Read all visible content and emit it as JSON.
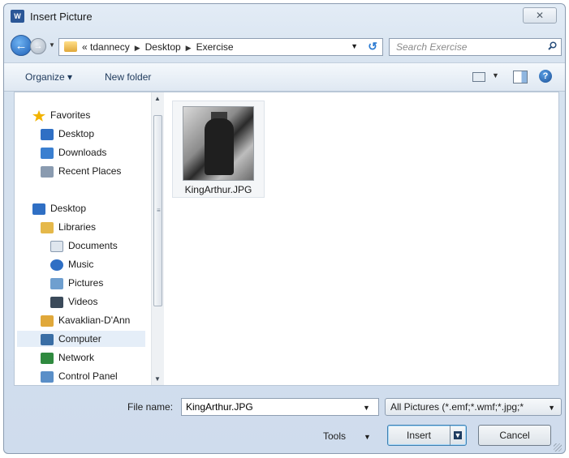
{
  "window": {
    "title": "Insert Picture",
    "app_icon_text": "W",
    "close_label": "✕"
  },
  "address": {
    "crumbs": [
      "« tdannecy",
      "Desktop",
      "Exercise"
    ],
    "search_placeholder": "Search Exercise"
  },
  "toolbar": {
    "organize_label": "Organize ▾",
    "new_folder_label": "New folder"
  },
  "nav": {
    "items": [
      {
        "label": "Favorites",
        "icon": "star-icon",
        "color": "#f2b300"
      },
      {
        "label": "Desktop",
        "icon": "desktop-icon",
        "color": "#2f6fc4"
      },
      {
        "label": "Downloads",
        "icon": "downloads-icon",
        "color": "#3a7fd0"
      },
      {
        "label": "Recent Places",
        "icon": "recent-places-icon",
        "color": "#8a9bb0"
      },
      {
        "label": "Desktop",
        "icon": "desktop-icon",
        "color": "#2f6fc4"
      },
      {
        "label": "Libraries",
        "icon": "libraries-icon",
        "color": "#e5b84a"
      },
      {
        "label": "Documents",
        "icon": "documents-icon",
        "color": "#dfe6ee"
      },
      {
        "label": "Music",
        "icon": "music-icon",
        "color": "#2f6fc4"
      },
      {
        "label": "Pictures",
        "icon": "pictures-icon",
        "color": "#6f9fcf"
      },
      {
        "label": "Videos",
        "icon": "videos-icon",
        "color": "#3b4a5a"
      },
      {
        "label": "Kavaklian-D'Ann",
        "icon": "user-folder-icon",
        "color": "#e0a83a"
      },
      {
        "label": "Computer",
        "icon": "computer-icon",
        "color": "#3a6ea5"
      },
      {
        "label": "Network",
        "icon": "network-icon",
        "color": "#2f8a3f"
      },
      {
        "label": "Control Panel",
        "icon": "control-panel-icon",
        "color": "#5a8fc8"
      }
    ]
  },
  "files": [
    {
      "name": "KingArthur.JPG"
    }
  ],
  "footer": {
    "file_name_label": "File name:",
    "file_name_value": "KingArthur.JPG",
    "file_type": "All Pictures (*.emf;*.wmf;*.jpg;*",
    "tools_label": "Tools",
    "insert_label": "Insert",
    "cancel_label": "Cancel"
  }
}
